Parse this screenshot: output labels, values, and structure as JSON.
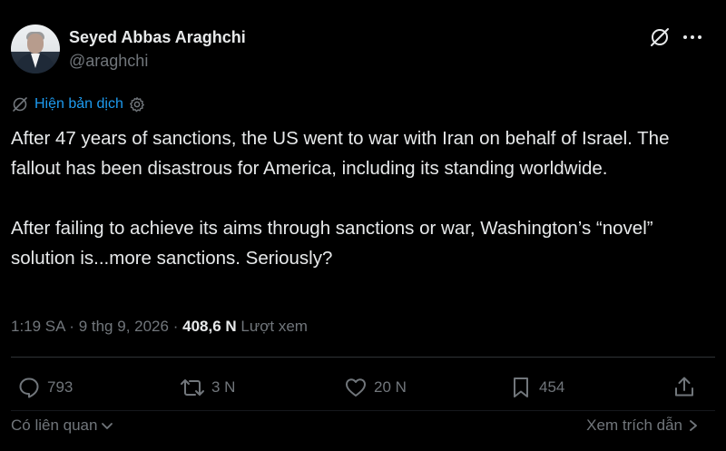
{
  "author": {
    "display_name": "Seyed Abbas Araghchi",
    "handle": "@araghchi"
  },
  "translate": {
    "label": "Hiện bản dịch"
  },
  "tweet": {
    "paragraphs": [
      "After 47 years of sanctions, the US went to war with Iran on behalf of Israel. The fallout has been disastrous for America, including its standing worldwide.",
      "After failing to achieve its aims through sanctions or war, Washington’s “novel” solution is...more sanctions. Seriously?"
    ]
  },
  "meta": {
    "time": "1:19 SA",
    "date": "9 thg 9, 2026",
    "views_count": "408,6 N",
    "views_label": "Lượt xem",
    "separator": "·"
  },
  "actions": {
    "replies": "793",
    "reposts": "3 N",
    "likes": "20 N",
    "bookmarks": "454"
  },
  "footer": {
    "related_label": "Có liên quan",
    "quotes_label": "Xem trích dẫn"
  },
  "colors": {
    "background": "#000000",
    "text": "#e7e9ea",
    "muted": "#71767b",
    "link": "#1d9bf0",
    "divider": "#2f3336"
  },
  "icons": [
    "grok-icon",
    "more-icon",
    "translate-icon",
    "settings-icon",
    "reply-icon",
    "repost-icon",
    "like-icon",
    "bookmark-icon",
    "share-icon",
    "chevron-down-icon",
    "chevron-right-icon"
  ]
}
